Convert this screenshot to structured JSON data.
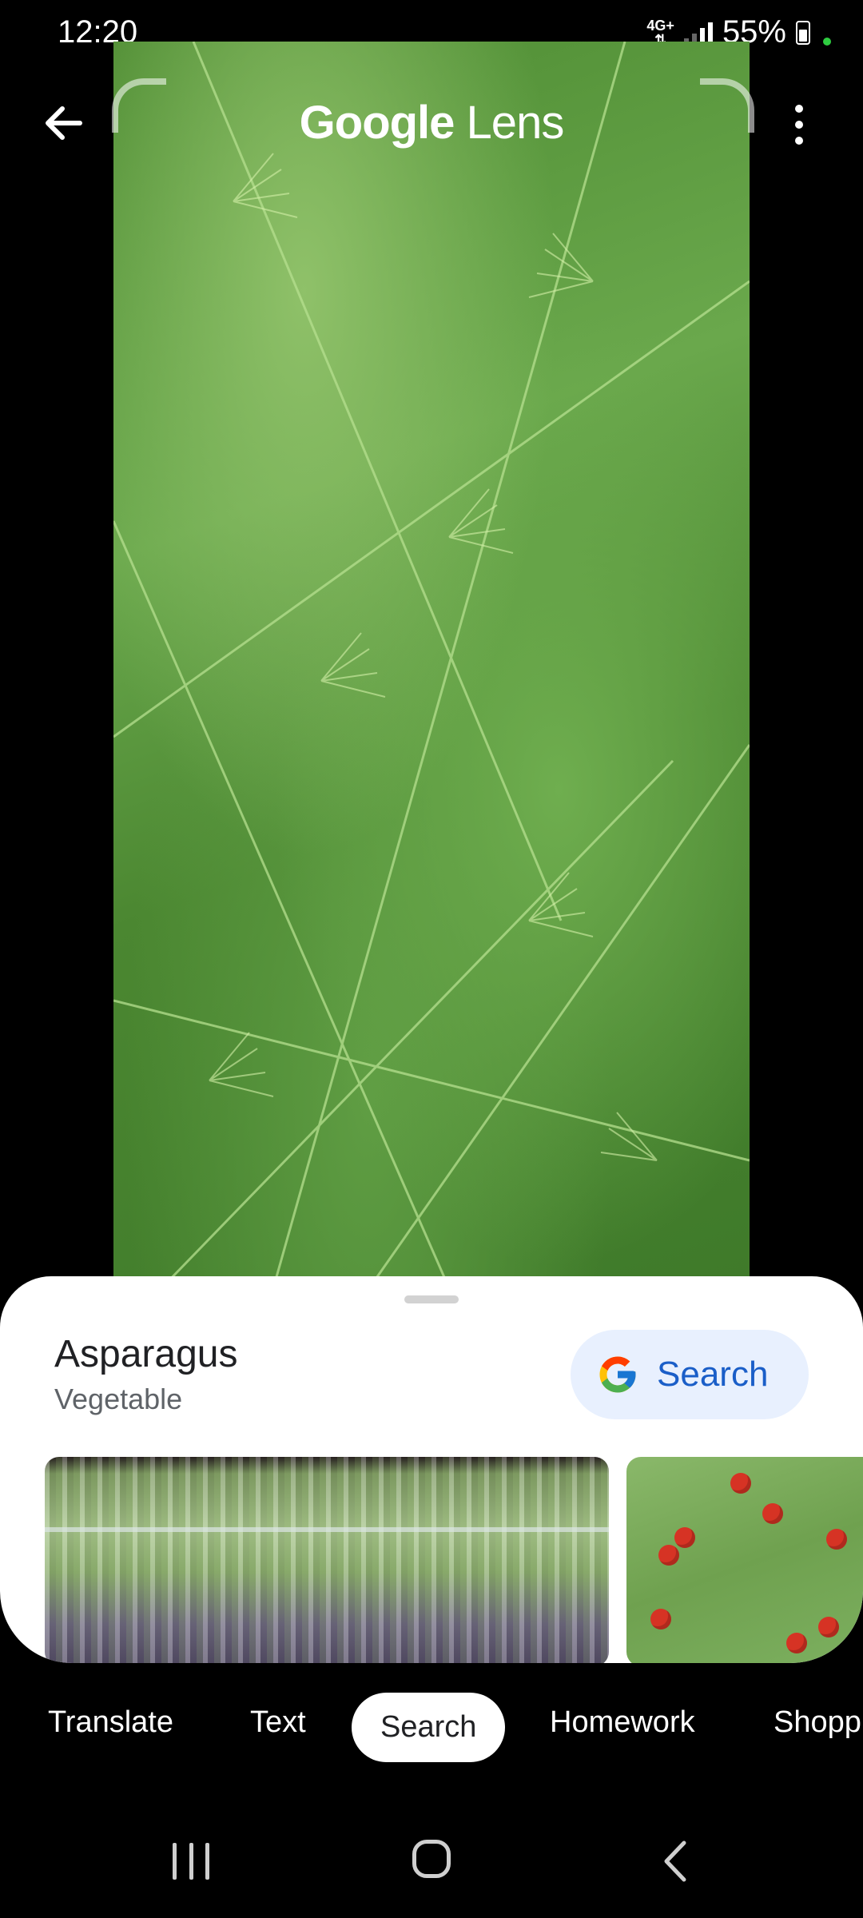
{
  "status_bar": {
    "time": "12:20",
    "network": "4G+",
    "battery": "55%",
    "signal_bars": 2
  },
  "header": {
    "title_bold": "Google",
    "title_rest": " Lens"
  },
  "result": {
    "name": "Asparagus",
    "type": "Vegetable",
    "search_label": "Search"
  },
  "tabs": [
    {
      "label": "Translate"
    },
    {
      "label": "Text"
    },
    {
      "label": "Search",
      "active": true
    },
    {
      "label": "Homework"
    },
    {
      "label": "Shopp"
    }
  ],
  "colors": {
    "accent": "#1a5ec8",
    "chip_bg": "#e8f0fe"
  },
  "icons": {
    "back": "arrow-left-icon",
    "more": "more-vert-icon",
    "google": "google-g-icon"
  }
}
